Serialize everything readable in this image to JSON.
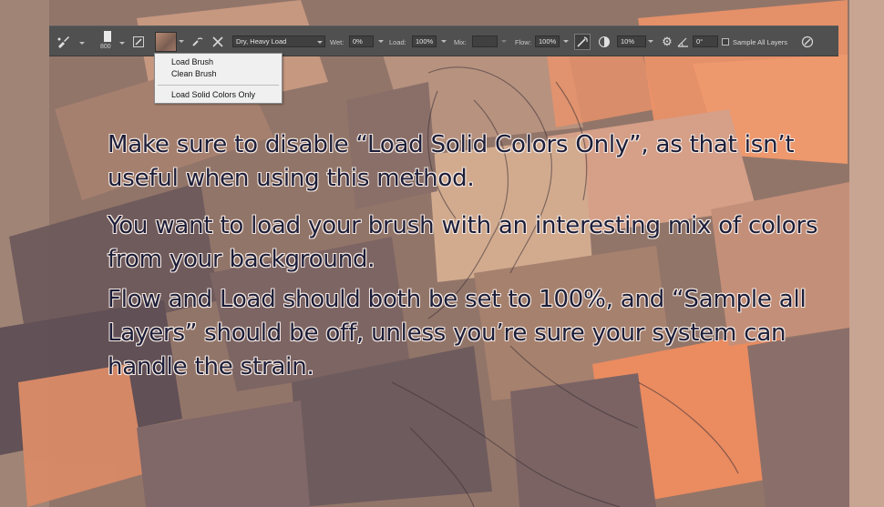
{
  "toolbar": {
    "brush_size": "800",
    "brush_preset": "Dry, Heavy Load",
    "wet_label": "Wet:",
    "wet_value": "0%",
    "load_label": "Load:",
    "load_value": "100%",
    "mix_label": "Mix:",
    "mix_value": "",
    "flow_label": "Flow:",
    "flow_value": "100%",
    "smoothing_value": "10%",
    "angle_value": "0°",
    "sample_all_layers_label": "Sample All Layers",
    "sample_all_layers_checked": false
  },
  "load_menu": {
    "items": [
      "Load Brush",
      "Clean Brush",
      "Load Solid Colors Only"
    ]
  },
  "instructions": {
    "p1": "Make sure to disable “Load Solid Colors Only”, as that isn’t useful when using this method.",
    "p2": "You want to load your brush with an interesting mix of colors from your background.",
    "p3": "Flow and Load should both be set to 100%, and “Sample all Layers” should be off, unless you’re sure your system can handle the strain."
  },
  "colors": {
    "toolbar_bg": "#505050",
    "menu_bg": "#f0f0f0",
    "text_fill": "#1c1e3a",
    "text_outline": "#f4e8e0",
    "paint_orange": "#f08a5c",
    "paint_mauve": "#7e6664"
  }
}
